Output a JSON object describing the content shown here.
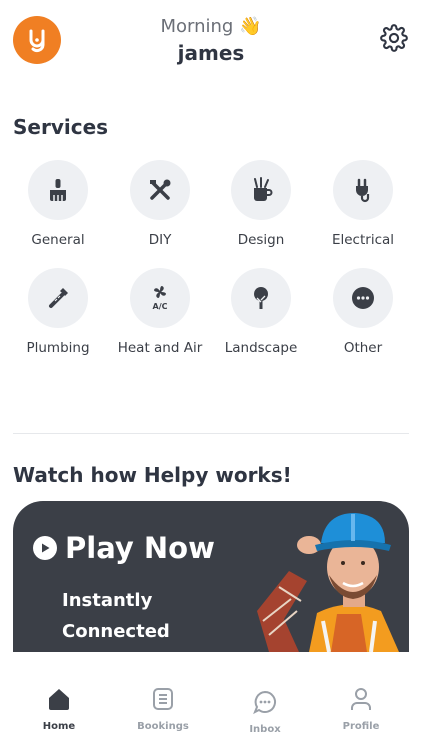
{
  "header": {
    "greeting": "Morning",
    "greeting_emoji": "👋",
    "username": "james",
    "logo_icon": "helpy-logo",
    "settings_icon": "gear-icon"
  },
  "services": {
    "title": "Services",
    "items": [
      {
        "label": "General",
        "icon": "brush-icon"
      },
      {
        "label": "DIY",
        "icon": "tools-icon"
      },
      {
        "label": "Design",
        "icon": "paint-cup-icon"
      },
      {
        "label": "Electrical",
        "icon": "plug-icon"
      },
      {
        "label": "Plumbing",
        "icon": "pipe-wrench-icon"
      },
      {
        "label": "Heat and Air",
        "icon": "ac-fan-icon"
      },
      {
        "label": "Landscape",
        "icon": "tree-icon"
      },
      {
        "label": "Other",
        "icon": "more-icon"
      }
    ]
  },
  "video": {
    "title": "Watch how Helpy works!",
    "play_label": "Play Now",
    "line1": "Instantly",
    "line2": "Connected"
  },
  "tabbar": {
    "items": [
      {
        "label": "Home",
        "icon": "home-icon",
        "active": true
      },
      {
        "label": "Bookings",
        "icon": "bookings-icon",
        "active": false
      },
      {
        "label": "Inbox",
        "icon": "chat-icon",
        "active": false
      },
      {
        "label": "Profile",
        "icon": "profile-icon",
        "active": false
      }
    ]
  },
  "colors": {
    "brand": "#f07f23",
    "dark": "#3b3f47",
    "tile": "#eef0f3",
    "muted": "#9aa0a8"
  }
}
